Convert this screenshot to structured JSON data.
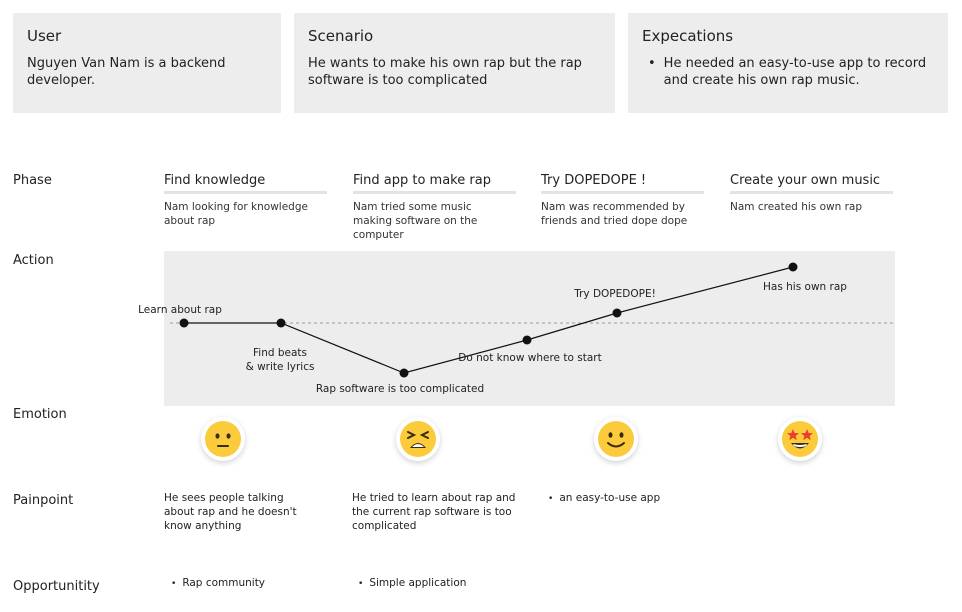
{
  "cards": {
    "user": {
      "title": "User",
      "text": "Nguyen Van Nam is a backend developer."
    },
    "scenario": {
      "title": "Scenario",
      "text": "He wants to make his own rap but the rap software is too complicated"
    },
    "expectations": {
      "title": "Expecations",
      "bullet": "He needed an easy-to-use app to record and create his own rap music."
    }
  },
  "rows": {
    "phase": "Phase",
    "action": "Action",
    "emotion": "Emotion",
    "painpoint": "Painpoint",
    "opportunity": "Opportunitity"
  },
  "phases": [
    {
      "title": "Find knowledge",
      "desc": "Nam looking for knowledge about rap"
    },
    {
      "title": "Find app to make rap",
      "desc": "Nam tried some music making software on the computer"
    },
    {
      "title": "Try DOPEDOPE !",
      "desc": "Nam was recommended by friends and tried dope dope"
    },
    {
      "title": "Create your own music",
      "desc": "Nam created his own rap"
    }
  ],
  "journey_points": [
    {
      "label": "Learn about rap",
      "level": 0
    },
    {
      "label": "Find beats & write lyrics",
      "level": 0
    },
    {
      "label": "Rap software is too complicated",
      "level": -1
    },
    {
      "label": "Do not know where to start",
      "level": -0.34
    },
    {
      "label": "Try DOPEDOPE!",
      "level": 0.2
    },
    {
      "label": "Has his own rap",
      "level": 1.12
    }
  ],
  "emotions": [
    {
      "icon": "neutral-face-icon"
    },
    {
      "icon": "tired-face-icon"
    },
    {
      "icon": "slightly-smiling-face-icon"
    },
    {
      "icon": "star-struck-face-icon"
    }
  ],
  "painpoints": [
    "He sees people talking about rap and he doesn't know anything",
    "He tried to learn about rap and the current rap software is too complicated",
    "an easy-to-use app"
  ],
  "opportunities": [
    "Rap community",
    "Simple application"
  ],
  "colors": {
    "card_bg": "#ededed",
    "emoji_yellow": "#fccb3b",
    "line": "#111111"
  }
}
